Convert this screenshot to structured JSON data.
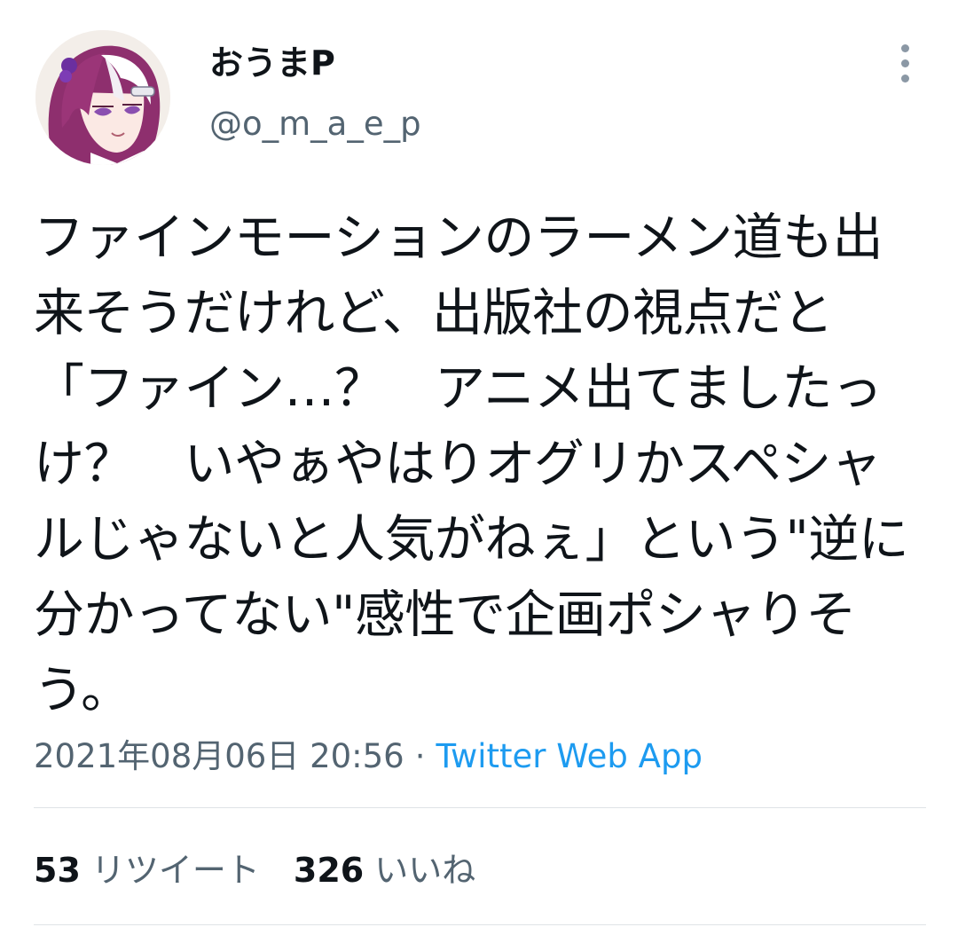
{
  "user": {
    "display_name": "おうまP",
    "handle": "@o_m_a_e_p",
    "avatar_icon": "anime-girl-avatar"
  },
  "tweet": {
    "text": "ファインモーションのラーメン道も出来そうだけれど、出版社の視点だと「ファイン…？　アニメ出てましたっけ？　いやぁやはりオグリかスペシャルじゃないと人気がねぇ」という\"逆に分かってない\"感性で企画ポシャりそう。",
    "timestamp": "2021年08月06日 20:56",
    "separator": "·",
    "source": "Twitter Web App"
  },
  "stats": {
    "retweets_count": "53",
    "retweets_label": "リツイート",
    "likes_count": "326",
    "likes_label": "いいね"
  },
  "colors": {
    "text": "#0f1419",
    "secondary": "#536471",
    "link": "#1d9bf0"
  }
}
